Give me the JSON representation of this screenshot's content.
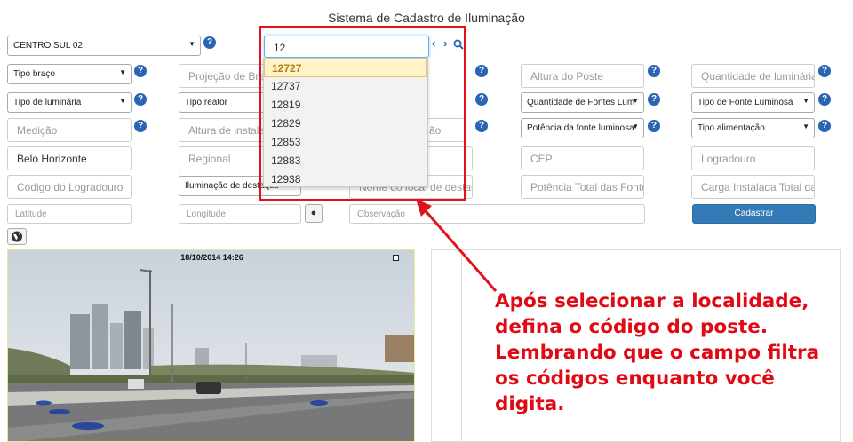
{
  "app": {
    "title": "Sistema de Cadastro de Iluminação"
  },
  "locality": {
    "value": "CENTRO SUL 02"
  },
  "search": {
    "value": "12",
    "suggestions": [
      "12727",
      "12737",
      "12819",
      "12829",
      "12853",
      "12883",
      "12938"
    ],
    "selected": "12727"
  },
  "fields": {
    "tipo_braco": "Tipo braço",
    "projecao_braco": "Projeção de Braço",
    "altura_poste": "Altura do Poste",
    "qtd_luminarias": "Quantidade de luminárias",
    "tipo_luminaria": "Tipo de luminária",
    "tipo_reator": "Tipo reator",
    "qtd_fontes": "Quantidade de Fontes Lum",
    "tipo_fonte": "Tipo de Fonte Luminosa",
    "medicao": "Medição",
    "altura_instalacao": "Altura de instalação",
    "row3_col3": "ão",
    "potencia_fonte": "Potência da fonte luminosa",
    "tipo_alimentacao": "Tipo alimentação",
    "cidade": "Belo Horizonte",
    "regional": "Regional",
    "cep": "CEP",
    "logradouro": "Logradouro",
    "codigo_logradouro": "Código do Logradouro",
    "iluminacao_destaque": "Iluminação de destaque",
    "nome_local_destaque": "Nome do local de destaque",
    "potencia_total": "Potência Total das Fontes",
    "carga_instalada": "Carga Instalada Total da",
    "latitude": "Latitude",
    "longitude": "Longitude",
    "observacao": "Observação"
  },
  "buttons": {
    "cadastrar": "Cadastrar"
  },
  "photo": {
    "timestamp": "18/10/2014 14:26"
  },
  "annotation": {
    "lines": [
      "Após selecionar a localidade,",
      "defina o código do poste.",
      "Lembrando que o campo filtra",
      "os códigos enquanto você",
      "digita."
    ]
  },
  "colors": {
    "accent": "#337ab7",
    "annotation": "#e00a14",
    "highlight": "#e1111d"
  }
}
